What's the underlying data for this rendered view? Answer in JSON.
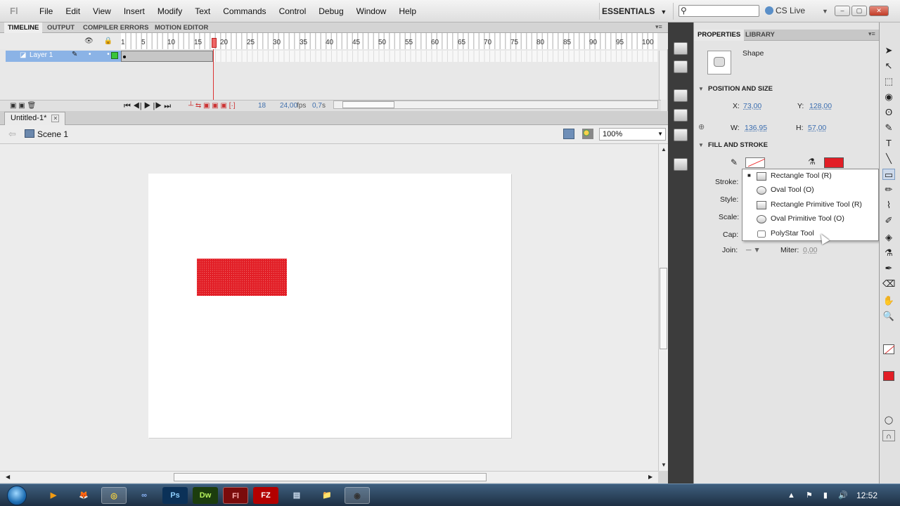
{
  "app": {
    "logo": "Fl"
  },
  "menu": [
    "File",
    "Edit",
    "View",
    "Insert",
    "Modify",
    "Text",
    "Commands",
    "Control",
    "Debug",
    "Window",
    "Help"
  ],
  "workspace": {
    "label": "ESSENTIALS",
    "caret": "▼"
  },
  "search": {
    "placeholder": "",
    "icon": "search-icon"
  },
  "cslive": {
    "label": "CS Live",
    "caret": "▼"
  },
  "window_buttons": {
    "minimize": "–",
    "maximize": "▢",
    "close": "✕"
  },
  "timeline": {
    "tabs": [
      "TIMELINE",
      "OUTPUT",
      "COMPILER ERRORS",
      "MOTION EDITOR"
    ],
    "active_tab": "TIMELINE",
    "ruler": [
      "1",
      "5",
      "10",
      "15",
      "20",
      "25",
      "30",
      "35",
      "40",
      "45",
      "50",
      "55",
      "60",
      "65",
      "70",
      "75",
      "80",
      "85",
      "90",
      "95",
      "100"
    ],
    "layer": {
      "name": "Layer 1",
      "dots": "• •"
    },
    "header_icons": "👁 🔒 ▢",
    "current_frame": "18",
    "fps": "24,00",
    "fps_unit": "fps",
    "time": "0,7",
    "time_unit": "s",
    "playback": "⏮ ◀| ▶ |▶ ⏭",
    "footer_icons": "┴ ⇆ ▣ ▣ ▣ [·]"
  },
  "document": {
    "tab": "Untitled-1*",
    "close": "✕",
    "scene": "Scene 1",
    "back": "⇦",
    "zoom": "100%",
    "zoom_caret": "▼"
  },
  "shape": {
    "fill_color": "#e21e26"
  },
  "properties": {
    "tabs": [
      "PROPERTIES",
      "LIBRARY"
    ],
    "active_tab": "PROPERTIES",
    "object_type": "Shape",
    "position_section": "POSITION AND SIZE",
    "x_label": "X:",
    "x_value": "73,00",
    "y_label": "Y:",
    "y_value": "128,00",
    "w_label": "W:",
    "w_value": "136,95",
    "h_label": "H:",
    "h_value": "57,00",
    "fill_section": "FILL AND STROKE",
    "stroke_label": "Stroke:",
    "style_label": "Style:",
    "scale_label": "Scale:",
    "cap_label": "Cap:",
    "join_label": "Join:",
    "join_value": "─ ▼",
    "miter_label": "Miter:",
    "miter_value": "0,00",
    "fill_color": "#e21e26"
  },
  "tool_menu": {
    "items": [
      {
        "label": "Rectangle Tool (R)",
        "icon": "rectangle-icon",
        "selected": true
      },
      {
        "label": "Oval Tool (O)",
        "icon": "oval-icon",
        "selected": false
      },
      {
        "label": "Rectangle Primitive Tool (R)",
        "icon": "rectangle-primitive-icon",
        "selected": false
      },
      {
        "label": "Oval Primitive Tool (O)",
        "icon": "oval-primitive-icon",
        "selected": false
      },
      {
        "label": "PolyStar Tool",
        "icon": "polystar-icon",
        "selected": false
      }
    ],
    "bullet": "■"
  },
  "tools": [
    "➤",
    "↖",
    "⬚",
    "◉",
    "ʘ",
    "✎",
    "T",
    "╲",
    "▭",
    "✏",
    "⌇",
    "✐",
    "◈",
    "⚗",
    "✒",
    "⌫",
    "✋",
    "🔍"
  ],
  "taskbar": {
    "apps": [
      "▶",
      "🦊",
      "◎",
      "∞",
      "Ps",
      "Dw",
      "Fl",
      "FZ",
      "▤",
      "📁",
      "◉"
    ],
    "tray": "▲ ⚑ ▮ 🔊",
    "clock": "12:52"
  }
}
